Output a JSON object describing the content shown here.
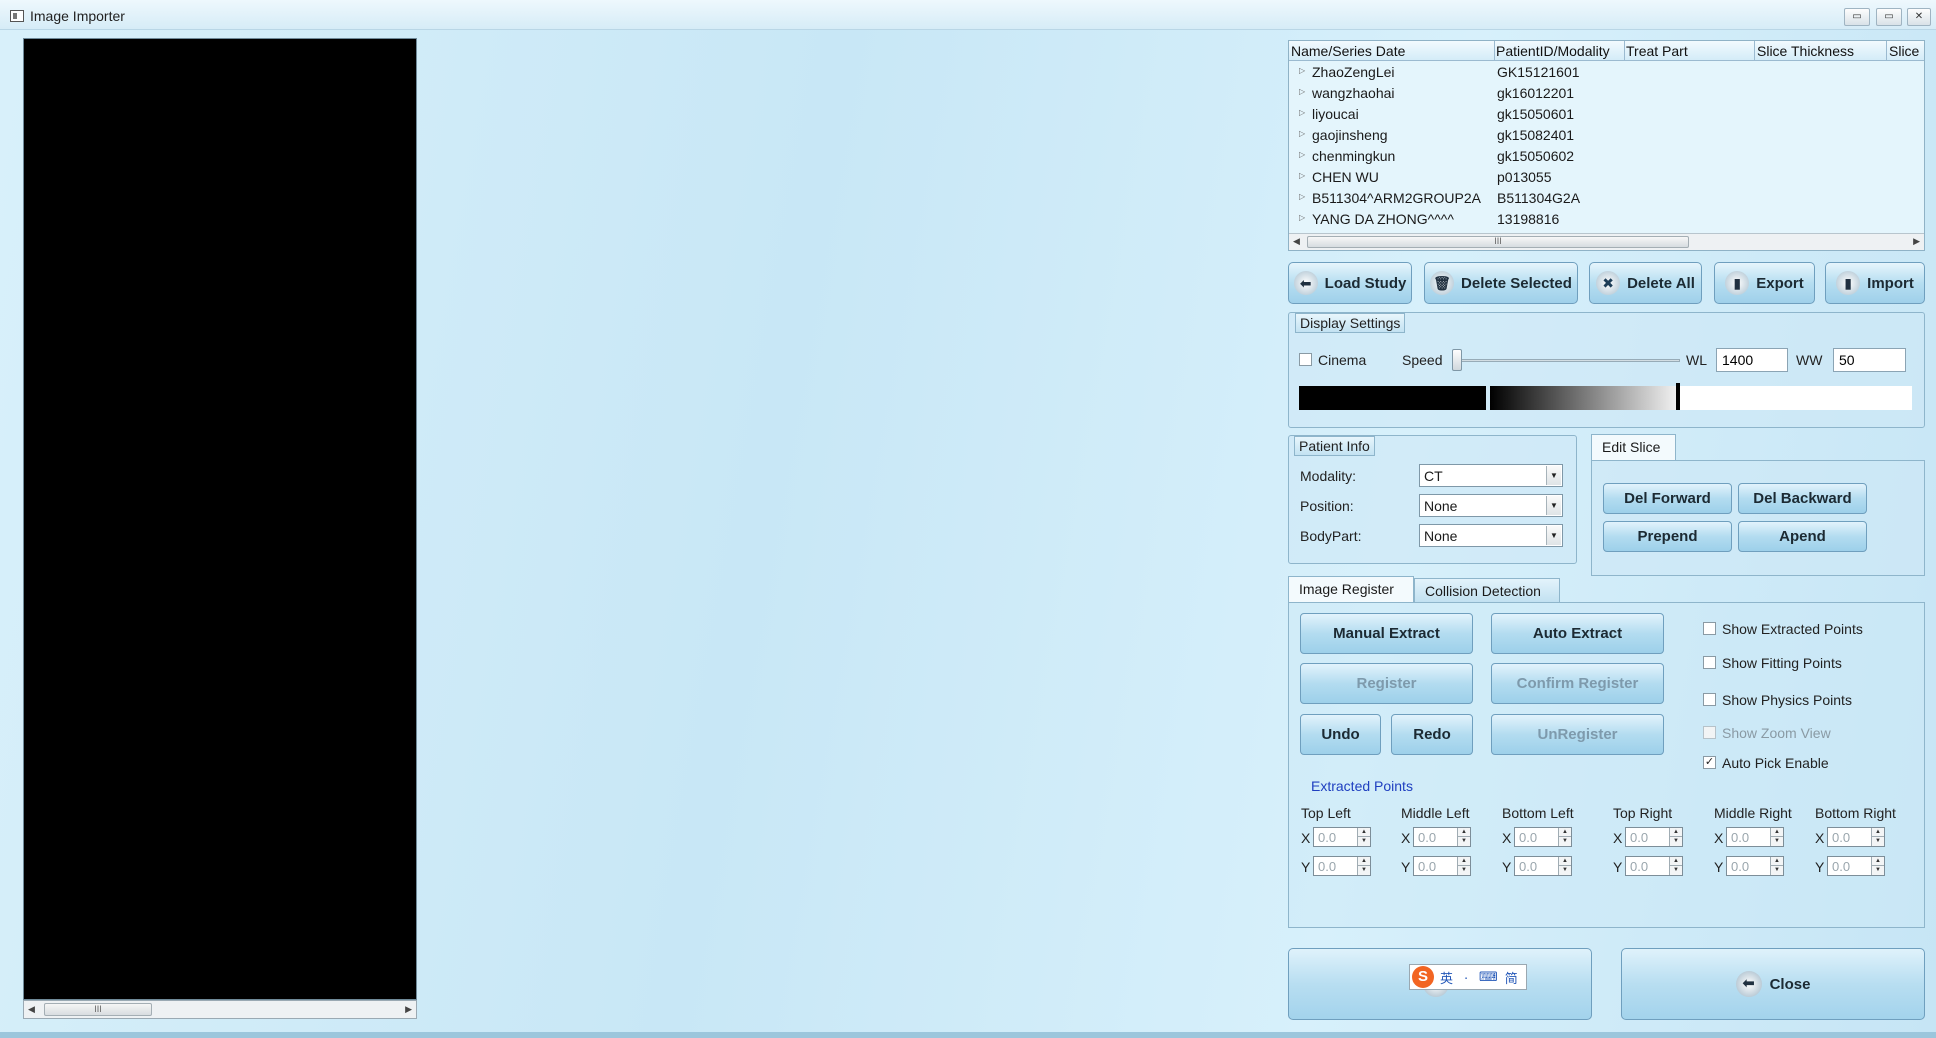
{
  "window": {
    "title": "Image Importer",
    "controls": [
      "▭",
      "▭",
      "✕"
    ]
  },
  "study_table": {
    "columns": [
      "Name/Series Date",
      "PatientID/Modality",
      "Treat Part",
      "Slice Thickness",
      "Slice"
    ],
    "rows": [
      {
        "name": "ZhaoZengLei",
        "pid": "GK15121601"
      },
      {
        "name": "wangzhaohai",
        "pid": "gk16012201"
      },
      {
        "name": "liyoucai",
        "pid": "gk15050601"
      },
      {
        "name": "gaojinsheng",
        "pid": "gk15082401"
      },
      {
        "name": "chenmingkun",
        "pid": "gk15050602"
      },
      {
        "name": "CHEN WU",
        "pid": "p013055"
      },
      {
        "name": "B511304^ARM2GROUP2A",
        "pid": "B511304G2A"
      },
      {
        "name": "YANG DA ZHONG^^^^",
        "pid": "13198816"
      }
    ],
    "scroll_grip": "III"
  },
  "toolbar": {
    "load_study": "Load Study",
    "delete_selected": "Delete Selected",
    "delete_all": "Delete All",
    "export": "Export",
    "import": "Import"
  },
  "display_settings": {
    "title": "Display Settings",
    "cinema_label": "Cinema",
    "cinema_checked": false,
    "speed_label": "Speed",
    "wl_label": "WL",
    "wl_value": "1400",
    "ww_label": "WW",
    "ww_value": "50"
  },
  "patient_info": {
    "title": "Patient Info",
    "modality_label": "Modality:",
    "modality_value": "CT",
    "position_label": "Position:",
    "position_value": "None",
    "bodypart_label": "BodyPart:",
    "bodypart_value": "None"
  },
  "edit_slice": {
    "tab": "Edit Slice",
    "del_forward": "Del Forward",
    "del_backward": "Del Backward",
    "prepend": "Prepend",
    "apend": "Apend"
  },
  "register_tabs": {
    "image_register": "Image Register",
    "collision_detection": "Collision Detection"
  },
  "image_register": {
    "manual_extract": "Manual Extract",
    "auto_extract": "Auto Extract",
    "register": "Register",
    "confirm_register": "Confirm Register",
    "undo": "Undo",
    "redo": "Redo",
    "unregister": "UnRegister",
    "options": [
      {
        "label": "Show Extracted Points",
        "checked": false,
        "enabled": true
      },
      {
        "label": "Show Fitting Points",
        "checked": false,
        "enabled": true
      },
      {
        "label": "Show Physics Points",
        "checked": false,
        "enabled": true
      },
      {
        "label": "Show Zoom View",
        "checked": false,
        "enabled": false
      },
      {
        "label": "Auto Pick Enable",
        "checked": true,
        "enabled": true
      }
    ],
    "extracted_points_title": "Extracted Points",
    "x_label": "X",
    "y_label": "Y",
    "points": [
      {
        "label": "Top Left",
        "x": "0.0",
        "y": "0.0"
      },
      {
        "label": "Middle Left",
        "x": "0.0",
        "y": "0.0"
      },
      {
        "label": "Bottom Left",
        "x": "0.0",
        "y": "0.0"
      },
      {
        "label": "Top Right",
        "x": "0.0",
        "y": "0.0"
      },
      {
        "label": "Middle Right",
        "x": "0.0",
        "y": "0.0"
      },
      {
        "label": "Bottom Right",
        "x": "0.0",
        "y": "0.0"
      }
    ]
  },
  "footer": {
    "close": "Close"
  },
  "ime": {
    "logo": "S",
    "items": [
      "英",
      "ㆍ",
      "⌨",
      "简"
    ]
  },
  "colors": {
    "accent": "#9dd0ea",
    "background": "#cde9f6",
    "viewer": "#000000"
  }
}
